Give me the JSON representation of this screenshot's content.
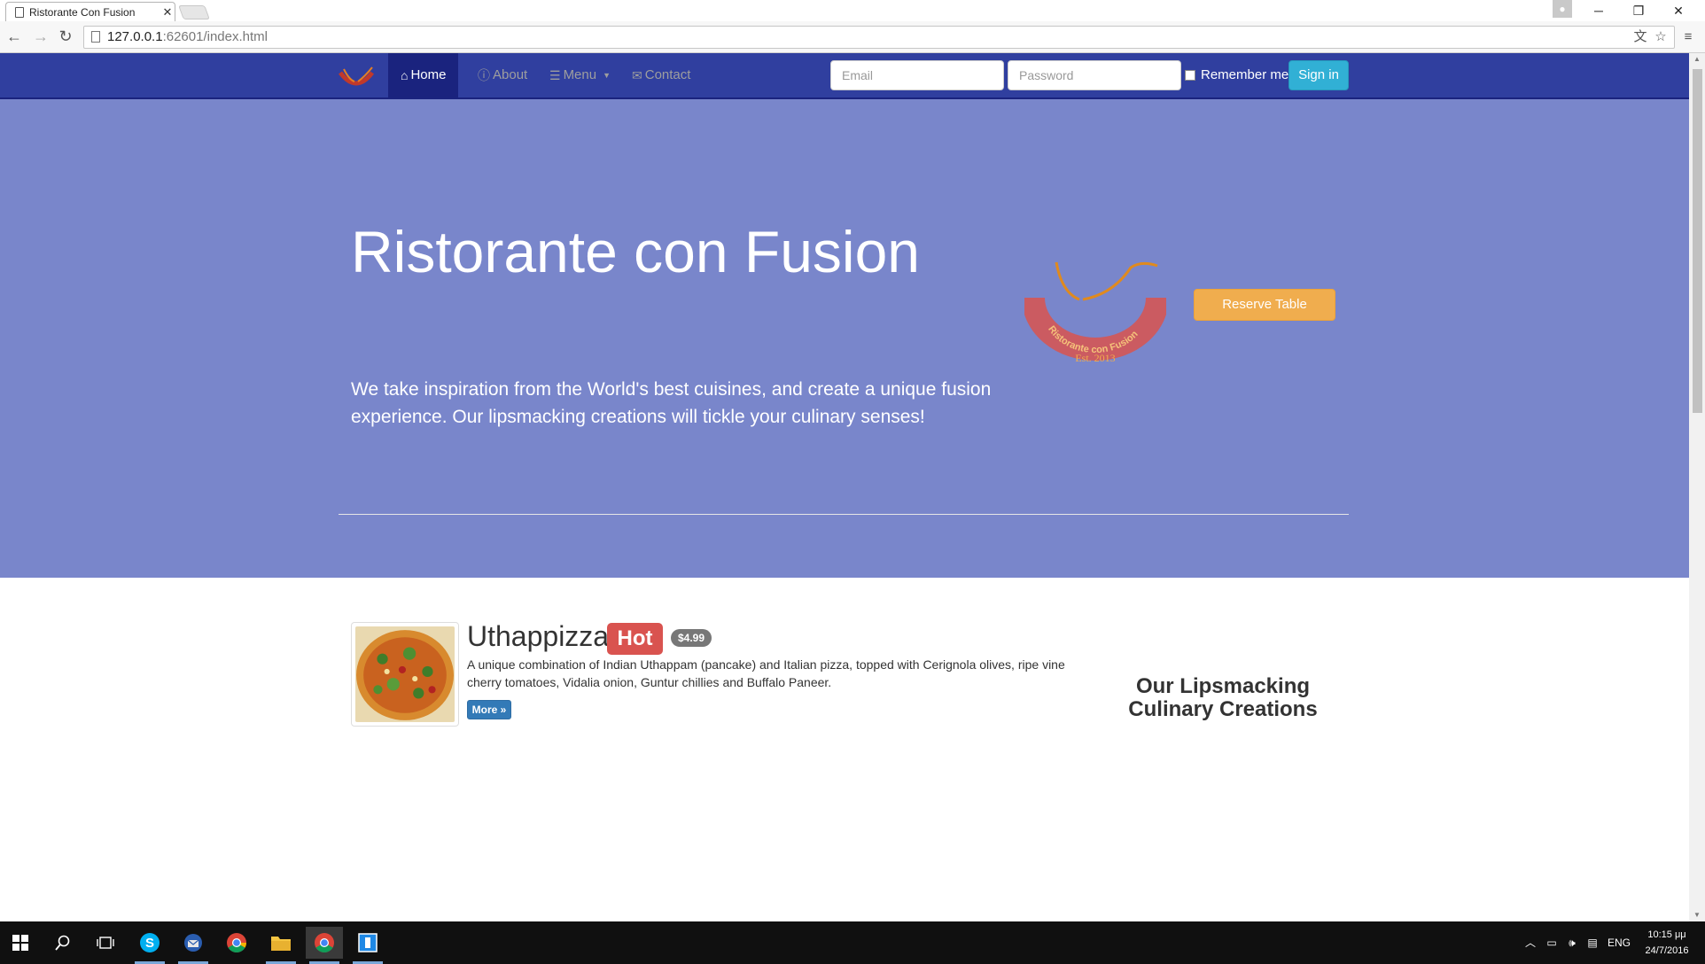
{
  "browser": {
    "tab_title": "Ristorante Con Fusion",
    "url_host": "127.0.0.1",
    "url_path": ":62601/index.html"
  },
  "navbar": {
    "items": [
      {
        "label": "Home",
        "icon": "home-icon",
        "active": true
      },
      {
        "label": "About",
        "icon": "info-icon",
        "active": false
      },
      {
        "label": "Menu",
        "icon": "list-icon",
        "active": false
      },
      {
        "label": "Contact",
        "icon": "envelope-icon",
        "active": false
      }
    ],
    "email_placeholder": "Email",
    "password_placeholder": "Password",
    "remember_label": "Remember me",
    "signin_label": "Sign in"
  },
  "jumbotron": {
    "title": "Ristorante con Fusion",
    "text": "We take inspiration from the World's best cuisines, and create a unique fusion experience. Our lipsmacking creations will tickle your culinary senses!",
    "reserve_label": "Reserve Table",
    "logo_text": "Ristorante con Fusion",
    "logo_est": "Est. 2013"
  },
  "featured": {
    "name": "Uthappizza",
    "badge": "Hot",
    "price": "$4.99",
    "description": "A unique combination of Indian Uthappam (pancake) and Italian pizza, topped with Cerignola olives, ripe vine cherry tomatoes, Vidalia onion, Guntur chillies and Buffalo Paneer.",
    "more_label": "More »"
  },
  "side": {
    "heading": "Our Lipsmacking Culinary Creations"
  },
  "taskbar": {
    "language": "ENG",
    "time": "10:15 μμ",
    "date": "24/7/2016"
  },
  "colors": {
    "navbar": "#303f9f",
    "navbar_active": "#1a237e",
    "jumbotron": "#7986cb",
    "reserve": "#f0ad4e",
    "hot_badge": "#d9534f",
    "signin": "#31b0d5"
  }
}
